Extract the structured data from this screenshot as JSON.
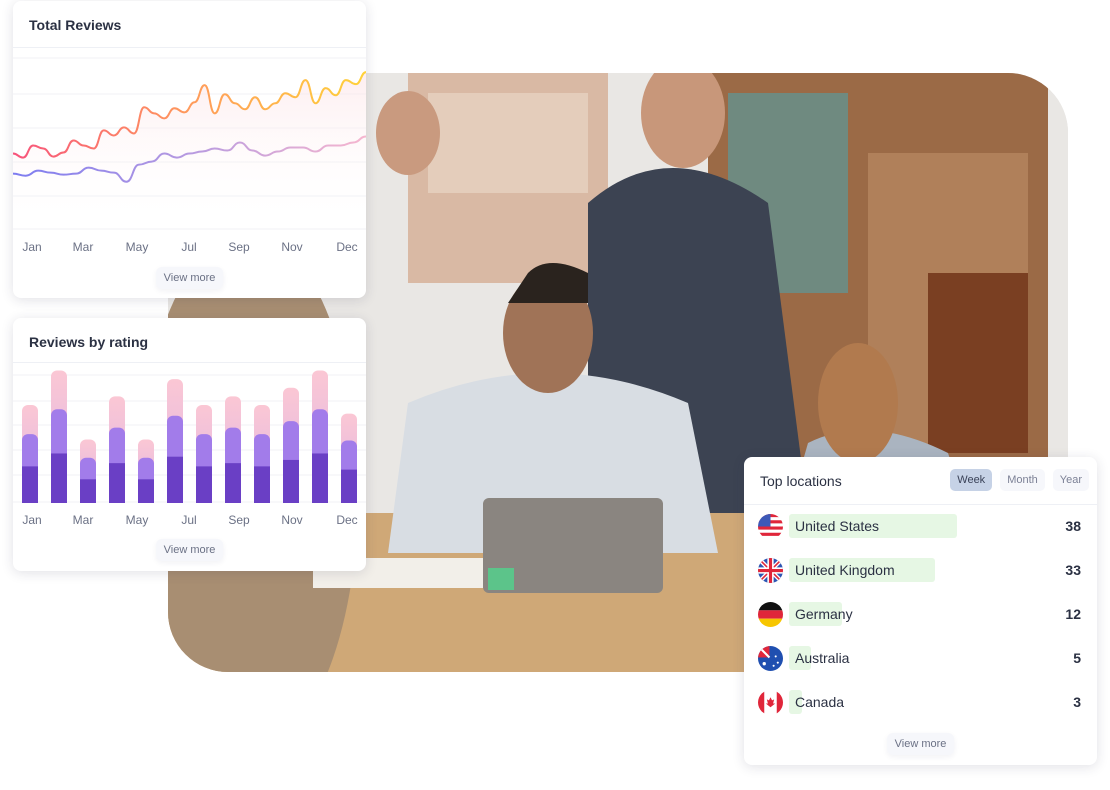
{
  "total_reviews": {
    "title": "Total Reviews",
    "months": [
      "Jan",
      "Mar",
      "May",
      "Jul",
      "Sep",
      "Nov",
      "Dec"
    ],
    "view_more": "View more"
  },
  "reviews_by_rating": {
    "title": "Reviews by rating",
    "months": [
      "Jan",
      "Mar",
      "May",
      "Jul",
      "Sep",
      "Nov",
      "Dec"
    ],
    "view_more": "View more"
  },
  "top_locations": {
    "title": "Top locations",
    "tabs": [
      {
        "label": "Week",
        "active": true
      },
      {
        "label": "Month",
        "active": false
      },
      {
        "label": "Year",
        "active": false
      }
    ],
    "items": [
      {
        "country": "United States",
        "count": "38",
        "flag": "us-flag-icon"
      },
      {
        "country": "United Kingdom",
        "count": "33",
        "flag": "uk-flag-icon"
      },
      {
        "country": "Germany",
        "count": "12",
        "flag": "germany-flag-icon"
      },
      {
        "country": "Australia",
        "count": "5",
        "flag": "australia-flag-icon"
      },
      {
        "country": "Canada",
        "count": "3",
        "flag": "canada-flag-icon"
      }
    ],
    "bar_color": "#e6f7e4",
    "view_more": "View more"
  },
  "chart_data": [
    {
      "type": "line",
      "title": "Total Reviews",
      "x_tick_labels": [
        "Jan",
        "Mar",
        "May",
        "Jul",
        "Sep",
        "Nov",
        "Dec"
      ],
      "grid": true,
      "series": [
        {
          "values": [
            75,
            71,
            83,
            80,
            72,
            76,
            88,
            83,
            80,
            98,
            93,
            101,
            95,
            121,
            115,
            110,
            120,
            116,
            126,
            143,
            115,
            134,
            125,
            119,
            131,
            119,
            125,
            135,
            131,
            148,
            125,
            140,
            133,
            148,
            144,
            156
          ],
          "colors": [
            "#f7547c",
            "#ff9a5c",
            "#ffd23a"
          ]
        },
        {
          "values": [
            55,
            53,
            58,
            56,
            54,
            55,
            61,
            58,
            56,
            47,
            64,
            67,
            75,
            71,
            75,
            77,
            80,
            78,
            86,
            78,
            73,
            77,
            81,
            81,
            77,
            83,
            83,
            86,
            92
          ],
          "colors": [
            "#7d7cf0",
            "#b79ae0",
            "#f6b6cf"
          ]
        }
      ],
      "ylim": [
        0,
        170
      ]
    },
    {
      "type": "bar",
      "stacked": true,
      "title": "Reviews by rating",
      "x_tick_labels": [
        "Jan",
        "Mar",
        "May",
        "Jul",
        "Sep",
        "Nov",
        "Dec"
      ],
      "grid": true,
      "bars": 12,
      "series": [
        {
          "color": "#6a3fc5",
          "values": [
            34,
            46,
            22,
            37,
            22,
            43,
            34,
            37,
            34,
            40,
            46,
            31
          ]
        },
        {
          "color": "#a27cea",
          "values": [
            30,
            41,
            20,
            33,
            20,
            38,
            30,
            33,
            30,
            36,
            41,
            27
          ]
        },
        {
          "color": "#fbc7d4",
          "values": [
            27,
            36,
            17,
            29,
            17,
            34,
            27,
            29,
            27,
            31,
            36,
            25
          ]
        }
      ],
      "ylim": [
        0,
        130
      ]
    }
  ]
}
